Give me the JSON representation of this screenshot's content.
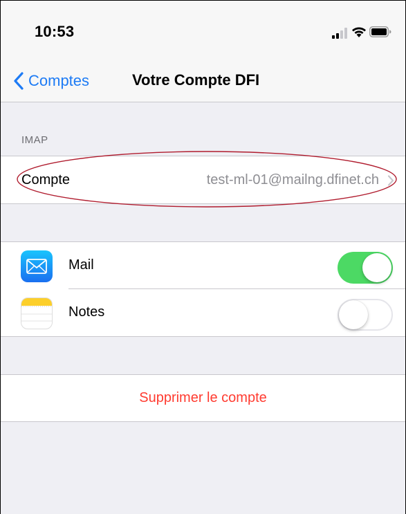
{
  "status_bar": {
    "time": "10:53",
    "icons": [
      "signal-icon",
      "wifi-icon",
      "battery-icon"
    ]
  },
  "navbar": {
    "back_label": "Comptes",
    "title": "Votre Compte DFI"
  },
  "imap_section": {
    "header": "IMAP",
    "account_label": "Compte",
    "account_value": "test-ml-01@mailng.dfinet.ch",
    "annotation_color": "#b01c2e"
  },
  "apps": [
    {
      "label": "Mail",
      "icon": "mail-icon",
      "enabled": true
    },
    {
      "label": "Notes",
      "icon": "notes-icon",
      "enabled": false
    }
  ],
  "delete": {
    "label": "Supprimer le compte"
  },
  "colors": {
    "accent": "#1d7bf5",
    "toggle_on": "#4cd964",
    "destructive": "#ff3b30",
    "background": "#efeff4"
  }
}
